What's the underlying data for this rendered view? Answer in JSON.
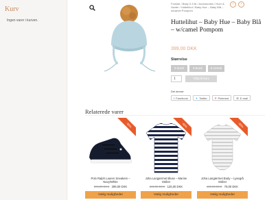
{
  "sidebar": {
    "title": "Kurv",
    "empty_text": "Ingen varer i kurven."
  },
  "breadcrumb": "Forside / Baby 0-3 år / Accessories / Huer & Vanter / Huttelihut / Baby Hue – Baby Blå – w/camel Pompom",
  "nav": {
    "prev": "‹",
    "next": "›"
  },
  "product": {
    "title": "Huttelihut – Baby Hue – Baby Blå – w/camel Pompom",
    "price": "399,00 DKK",
    "size_label": "Størrelse",
    "sizes": [
      "0-3mdr",
      "3-6mdr",
      "6-12mdr"
    ],
    "quantity": "1",
    "add_to_cart": "Tilføj til kurv"
  },
  "share": {
    "label": "Del denne:",
    "buttons": [
      "Facebook",
      "Twitter",
      "Pinterest",
      "E-mail"
    ]
  },
  "related": {
    "title": "Relaterede varer",
    "items": [
      {
        "badge": "-50%",
        "name": "Polo Ralph Lauren Sneakers – Navy/White",
        "old_price": "599,00 DKK",
        "new_price": "299,00 DKK",
        "button": "Vælg muligheder"
      },
      {
        "badge": "-50%",
        "name": "Joha Langærmet Bluse – Marine Striber",
        "old_price": "249,95 DKK",
        "new_price": "125,00 DKK",
        "button": "Vælg muligheder"
      },
      {
        "badge": "-50%",
        "name": "Joha Langærmet Body – Lysegrå Striber",
        "old_price": "159,95 DKK",
        "new_price": "79,00 DKK",
        "button": "Vælg muligheder"
      }
    ]
  },
  "colors": {
    "accent": "#e2a47c",
    "badge": "#e85a2a",
    "button": "#f0a24a"
  }
}
